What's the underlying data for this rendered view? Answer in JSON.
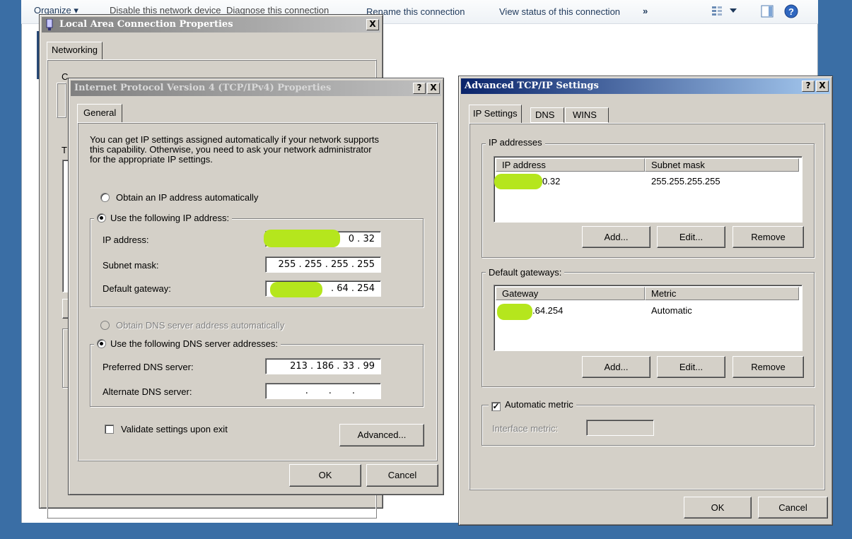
{
  "explorer": {
    "toolbar": {
      "organize": "Organize",
      "disable": "Disable this network device",
      "diagnose": "Diagnose this connection",
      "rename": "Rename this connection",
      "view_status": "View status of this connection",
      "more": "»"
    }
  },
  "lac_dialog": {
    "title": "Local Area Connection Properties",
    "tab": "Networking",
    "connect_label_partial": "C",
    "this_label_partial": "T"
  },
  "ipv4_dialog": {
    "title": "Internet Protocol Version 4 (TCP/IPv4) Properties",
    "help": "?",
    "close": "X",
    "tab": "General",
    "description_line1": "You can get IP settings assigned automatically if your network supports",
    "description_line2": "this capability. Otherwise, you need to ask your network administrator",
    "description_line3": "for the appropriate IP settings.",
    "obtain_ip_auto": "Obtain an IP address automatically",
    "use_following_ip": "Use the following IP address:",
    "ip_address_label": "IP address:",
    "ip_address_value": "0 . 32",
    "subnet_label": "Subnet mask:",
    "subnet_value": "255 . 255 . 255 . 255",
    "gateway_label": "Default gateway:",
    "gateway_value": ". 64 . 254",
    "obtain_dns_auto": "Obtain DNS server address automatically",
    "use_following_dns": "Use the following DNS server addresses:",
    "preferred_dns_label": "Preferred DNS server:",
    "preferred_dns_value": "213 . 186 . 33 . 99",
    "alternate_dns_label": "Alternate DNS server:",
    "alternate_dns_value": ".       .       .",
    "validate_label": "Validate settings upon exit",
    "advanced_button": "Advanced...",
    "ok_button": "OK",
    "cancel_button": "Cancel"
  },
  "adv_dialog": {
    "title": "Advanced TCP/IP Settings",
    "help": "?",
    "close": "X",
    "tabs": [
      "IP Settings",
      "DNS",
      "WINS"
    ],
    "ip_group_label": "IP addresses",
    "ip_col_address": "IP address",
    "ip_col_mask": "Subnet mask",
    "ip_row_address": "0.32",
    "ip_row_mask": "255.255.255.255",
    "gw_group_label": "Default gateways:",
    "gw_col_gateway": "Gateway",
    "gw_col_metric": "Metric",
    "gw_row_gateway": ".64.254",
    "gw_row_metric": "Automatic",
    "add_button": "Add...",
    "edit_button": "Edit...",
    "remove_button": "Remove",
    "auto_metric_label": "Automatic metric",
    "interface_metric_label": "Interface metric:",
    "ok_button": "OK",
    "cancel_button": "Cancel"
  },
  "colors": {
    "desktop": "#3a6ea5",
    "active_title": "#0a246a",
    "dialog_face": "#d4d0c8",
    "redaction": "#b5e61d"
  }
}
